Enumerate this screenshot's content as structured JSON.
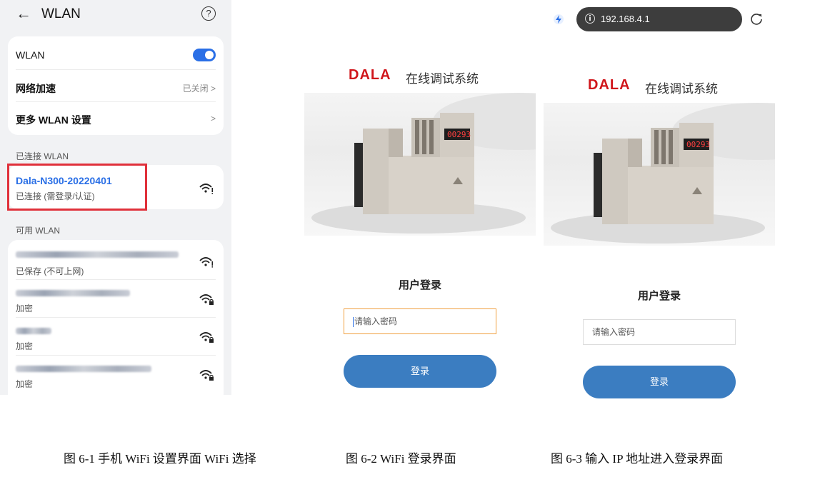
{
  "figure1": {
    "back_glyph": "←",
    "title": "WLAN",
    "help_glyph": "?",
    "settings": [
      {
        "label": "WLAN",
        "control": "toggle-on"
      },
      {
        "label": "网络加速",
        "value": "已关闭 >"
      },
      {
        "label": "更多 WLAN 设置",
        "value": ">"
      }
    ],
    "connected_section": "已连接 WLAN",
    "connected_network": {
      "name": "Dala-N300-20220401",
      "status": "已连接 (需登录/认证)"
    },
    "available_section": "可用 WLAN",
    "available_networks": [
      {
        "status": "已保存 (不可上网)"
      },
      {
        "status": "加密"
      },
      {
        "status": "加密"
      },
      {
        "status": "加密"
      }
    ],
    "highlight_color": "#e0303a",
    "accent_color": "#2a6fe6"
  },
  "figure2": {
    "logo_text": "DALA",
    "logo_subtitle": "在线调试系统",
    "device_display": "00293",
    "login_title": "用户登录",
    "password_placeholder": "请输入密码",
    "login_button": "登录"
  },
  "figure3": {
    "url": "192.168.4.1",
    "logo_text": "DALA",
    "logo_subtitle": "在线调试系统",
    "device_display": "00293",
    "login_title": "用户登录",
    "password_placeholder": "请输入密码",
    "login_button": "登录"
  },
  "captions": {
    "fig1": "图 6-1 手机 WiFi 设置界面 WiFi 选择",
    "fig2": "图 6-2  WiFi 登录界面",
    "fig3": "图 6-3 输入 IP 地址进入登录界面"
  },
  "colors": {
    "brand_red": "#d0161b",
    "button_blue": "#3b7dc1"
  }
}
